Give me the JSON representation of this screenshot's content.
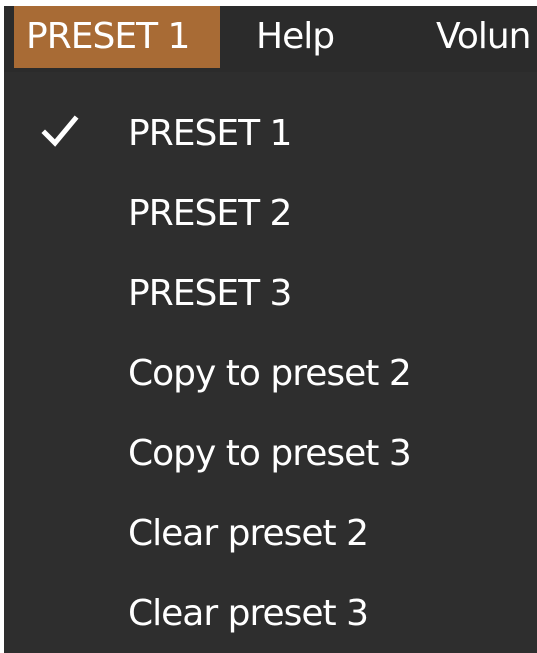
{
  "menubar": {
    "items": [
      {
        "label": "PRESET 1",
        "active": true
      },
      {
        "label": "Help",
        "active": false
      },
      {
        "label": "Volun",
        "active": false
      }
    ]
  },
  "dropdown": {
    "items": [
      {
        "label": "PRESET 1",
        "checked": true,
        "icon": "check-icon"
      },
      {
        "label": "PRESET 2",
        "checked": false
      },
      {
        "label": "PRESET 3",
        "checked": false
      },
      {
        "label": "Copy to preset 2",
        "checked": false
      },
      {
        "label": "Copy to preset 3",
        "checked": false
      },
      {
        "label": "Clear preset 2",
        "checked": false
      },
      {
        "label": "Clear preset 3",
        "checked": false
      }
    ]
  },
  "colors": {
    "menu_background": "#2d2d2d",
    "active_highlight": "#a86b35",
    "text": "#ffffff"
  }
}
